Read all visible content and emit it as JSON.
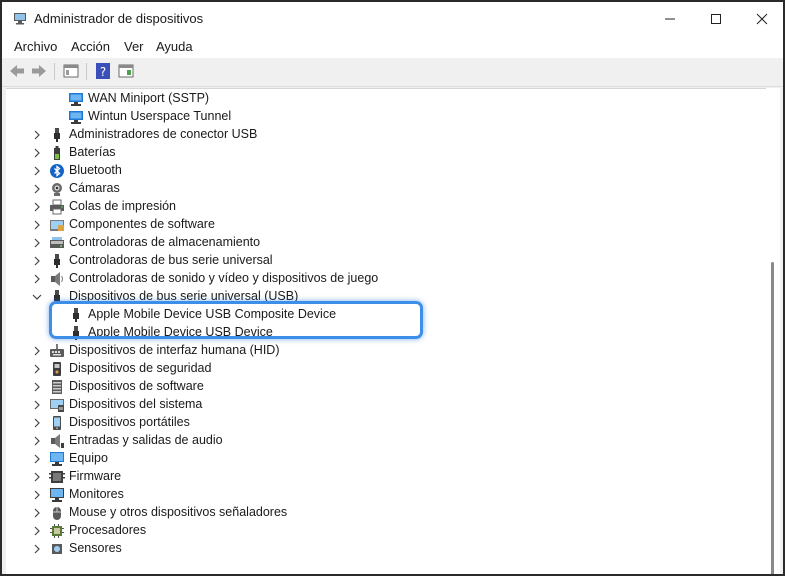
{
  "window": {
    "title": "Administrador de dispositivos"
  },
  "menu": [
    "Archivo",
    "Acción",
    "Ver",
    "Ayuda"
  ],
  "tree": [
    {
      "label": "WAN Miniport (SSTP)",
      "icon": "network-adapter-icon",
      "level": 2,
      "expander": "none"
    },
    {
      "label": "Wintun Userspace Tunnel",
      "icon": "network-adapter-icon",
      "level": 2,
      "expander": "none"
    },
    {
      "label": "Administradores de conector USB",
      "icon": "usb-plug-icon",
      "level": 1,
      "expander": "collapsed"
    },
    {
      "label": "Baterías",
      "icon": "battery-icon",
      "level": 1,
      "expander": "collapsed"
    },
    {
      "label": "Bluetooth",
      "icon": "bluetooth-icon",
      "level": 1,
      "expander": "collapsed"
    },
    {
      "label": "Cámaras",
      "icon": "camera-icon",
      "level": 1,
      "expander": "collapsed"
    },
    {
      "label": "Colas de impresión",
      "icon": "printer-icon",
      "level": 1,
      "expander": "collapsed"
    },
    {
      "label": "Componentes de software",
      "icon": "software-component-icon",
      "level": 1,
      "expander": "collapsed"
    },
    {
      "label": "Controladoras de almacenamiento",
      "icon": "storage-controller-icon",
      "level": 1,
      "expander": "collapsed"
    },
    {
      "label": "Controladoras de bus serie universal",
      "icon": "usb-plug-icon",
      "level": 1,
      "expander": "collapsed"
    },
    {
      "label": "Controladoras de sonido y vídeo y dispositivos de juego",
      "icon": "speaker-icon",
      "level": 1,
      "expander": "collapsed"
    },
    {
      "label": "Dispositivos de bus serie universal (USB)",
      "icon": "usb-plug-icon",
      "level": 1,
      "expander": "expanded"
    },
    {
      "label": "Apple Mobile Device USB Composite Device",
      "icon": "usb-plug-icon",
      "level": 2,
      "expander": "none"
    },
    {
      "label": "Apple Mobile Device USB Device",
      "icon": "usb-plug-icon",
      "level": 2,
      "expander": "none"
    },
    {
      "label": "Dispositivos de interfaz humana (HID)",
      "icon": "hid-icon",
      "level": 1,
      "expander": "collapsed"
    },
    {
      "label": "Dispositivos de seguridad",
      "icon": "security-device-icon",
      "level": 1,
      "expander": "collapsed"
    },
    {
      "label": "Dispositivos de software",
      "icon": "software-device-icon",
      "level": 1,
      "expander": "collapsed"
    },
    {
      "label": "Dispositivos del sistema",
      "icon": "system-device-icon",
      "level": 1,
      "expander": "collapsed"
    },
    {
      "label": "Dispositivos portátiles",
      "icon": "portable-device-icon",
      "level": 1,
      "expander": "collapsed"
    },
    {
      "label": "Entradas y salidas de audio",
      "icon": "audio-io-icon",
      "level": 1,
      "expander": "collapsed"
    },
    {
      "label": "Equipo",
      "icon": "computer-icon",
      "level": 1,
      "expander": "collapsed"
    },
    {
      "label": "Firmware",
      "icon": "firmware-icon",
      "level": 1,
      "expander": "collapsed"
    },
    {
      "label": "Monitores",
      "icon": "monitor-icon",
      "level": 1,
      "expander": "collapsed"
    },
    {
      "label": "Mouse y otros dispositivos señaladores",
      "icon": "mouse-icon",
      "level": 1,
      "expander": "collapsed"
    },
    {
      "label": "Procesadores",
      "icon": "processor-icon",
      "level": 1,
      "expander": "collapsed"
    },
    {
      "label": "Sensores",
      "icon": "sensor-icon",
      "level": 1,
      "expander": "collapsed"
    }
  ],
  "colors": {
    "highlight": "#3d8ee8",
    "network": "#1e78d4",
    "bluetooth": "#1464c8"
  }
}
